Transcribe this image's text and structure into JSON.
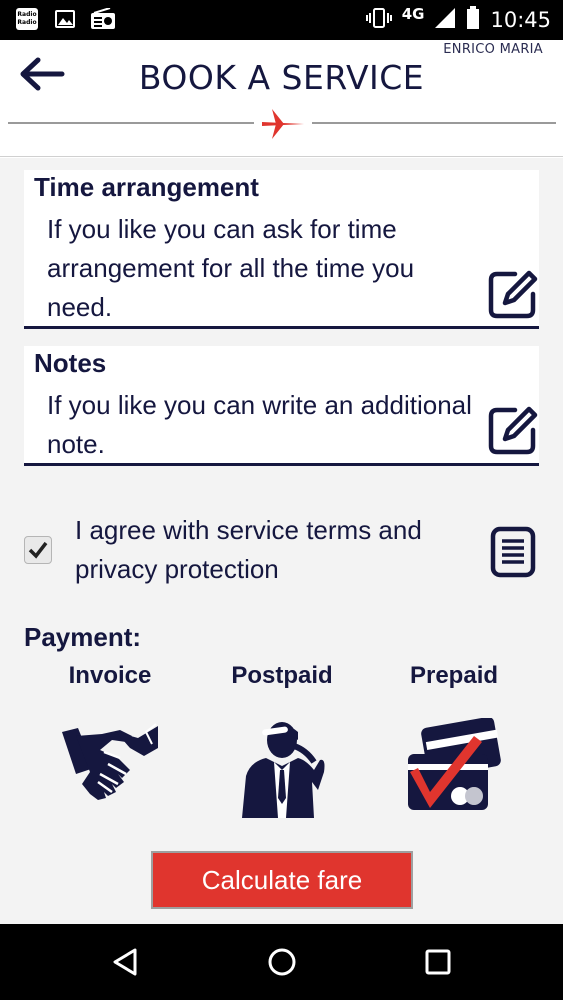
{
  "status_bar": {
    "time": "10:45",
    "network": "4G",
    "radio_app_label": "Radio Radio"
  },
  "header": {
    "user_name": "ENRICO MARIA",
    "title": "BOOK A SERVICE"
  },
  "time_arrangement": {
    "title": "Time arrangement",
    "text": "If you like you can ask for time arrangement for all the time you need."
  },
  "notes": {
    "title": "Notes",
    "text": "If you like you can write an additional note."
  },
  "agreement": {
    "checked": true,
    "text": "I agree with service terms and privacy protection"
  },
  "payment": {
    "title": "Payment:",
    "options": [
      {
        "label": "Invoice",
        "icon": "handshake-icon"
      },
      {
        "label": "Postpaid",
        "icon": "businessman-phone-icon"
      },
      {
        "label": "Prepaid",
        "icon": "card-check-icon"
      }
    ]
  },
  "calculate_button": {
    "label": "Calculate fare"
  },
  "colors": {
    "navy": "#15173f",
    "accent_red": "#e0352e",
    "background": "#f3f3f3"
  }
}
